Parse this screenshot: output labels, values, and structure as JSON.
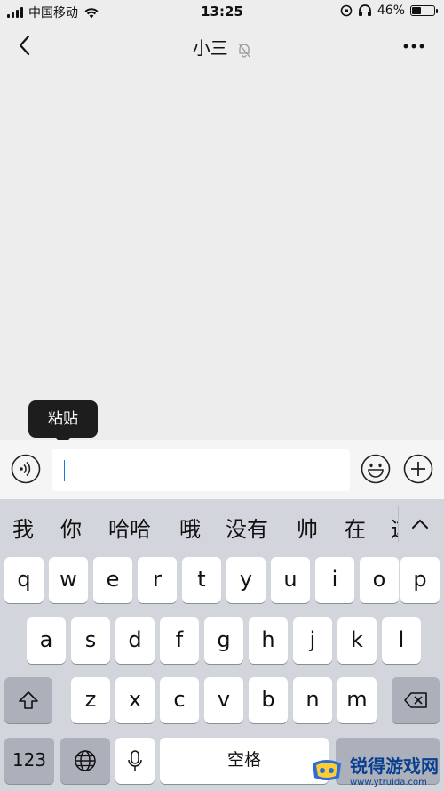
{
  "status_bar": {
    "carrier": "中国移动",
    "time": "13:25",
    "battery_percent": "46%",
    "battery_level": 0.46
  },
  "nav": {
    "title": "小三"
  },
  "tooltip": {
    "label": "粘贴"
  },
  "input": {
    "value": ""
  },
  "candidates": [
    "我",
    "你",
    "哈哈",
    "哦",
    "没有",
    "帅",
    "在",
    "这"
  ],
  "keyboard": {
    "row1": [
      "q",
      "w",
      "e",
      "r",
      "t",
      "y",
      "u",
      "i",
      "o",
      "p"
    ],
    "row2": [
      "a",
      "s",
      "d",
      "f",
      "g",
      "h",
      "j",
      "k",
      "l"
    ],
    "row3": [
      "z",
      "x",
      "c",
      "v",
      "b",
      "n",
      "m"
    ],
    "numbers_label": "123",
    "space_label": "空格"
  },
  "watermark": {
    "text": "锐得游戏网",
    "url": "www.ytruida.com"
  },
  "colors": {
    "chat_background": "#ededed",
    "keyboard_background": "#d2d5db",
    "tooltip_background": "#1d1d1d",
    "caret": "#1a7ad6"
  }
}
